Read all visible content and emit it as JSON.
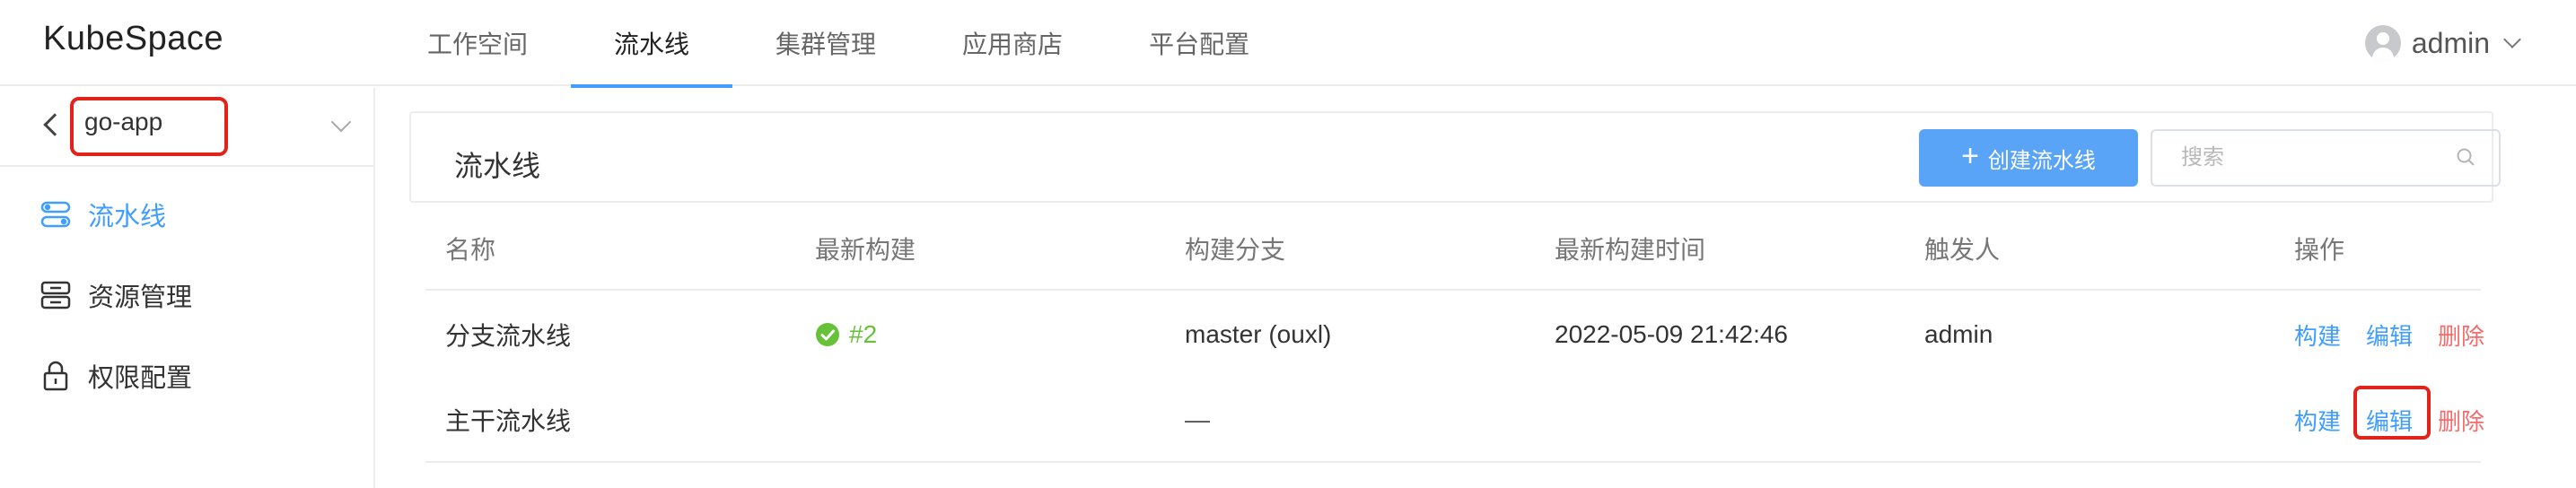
{
  "brand": "KubeSpace",
  "nav": {
    "tabs": [
      {
        "label": "工作空间",
        "active": false
      },
      {
        "label": "流水线",
        "active": true
      },
      {
        "label": "集群管理",
        "active": false
      },
      {
        "label": "应用商店",
        "active": false
      },
      {
        "label": "平台配置",
        "active": false
      }
    ],
    "user": {
      "name": "admin",
      "icon": "user-avatar-icon"
    }
  },
  "sidebar": {
    "project": "go-app",
    "items": [
      {
        "label": "流水线",
        "icon": "pipeline-icon",
        "active": true
      },
      {
        "label": "资源管理",
        "icon": "resource-icon",
        "active": false
      },
      {
        "label": "权限配置",
        "icon": "lock-icon",
        "active": false
      }
    ]
  },
  "main": {
    "title": "流水线",
    "create_label": "创建流水线",
    "search_placeholder": "搜索"
  },
  "table": {
    "headers": [
      "名称",
      "最新构建",
      "构建分支",
      "最新构建时间",
      "触发人",
      "操作"
    ],
    "rows": [
      {
        "name": "分支流水线",
        "build": "#2",
        "build_status": "success",
        "branch": "master (ouxl)",
        "time": "2022-05-09 21:42:46",
        "trigger": "admin"
      },
      {
        "name": "主干流水线",
        "build": "",
        "build_status": "",
        "branch": "—",
        "time": "",
        "trigger": ""
      }
    ],
    "actions": {
      "build": "构建",
      "edit": "编辑",
      "delete": "删除"
    }
  },
  "colors": {
    "accent": "#409eff",
    "success": "#67c23a",
    "danger": "#f56c6c",
    "highlight": "#e2231a"
  }
}
